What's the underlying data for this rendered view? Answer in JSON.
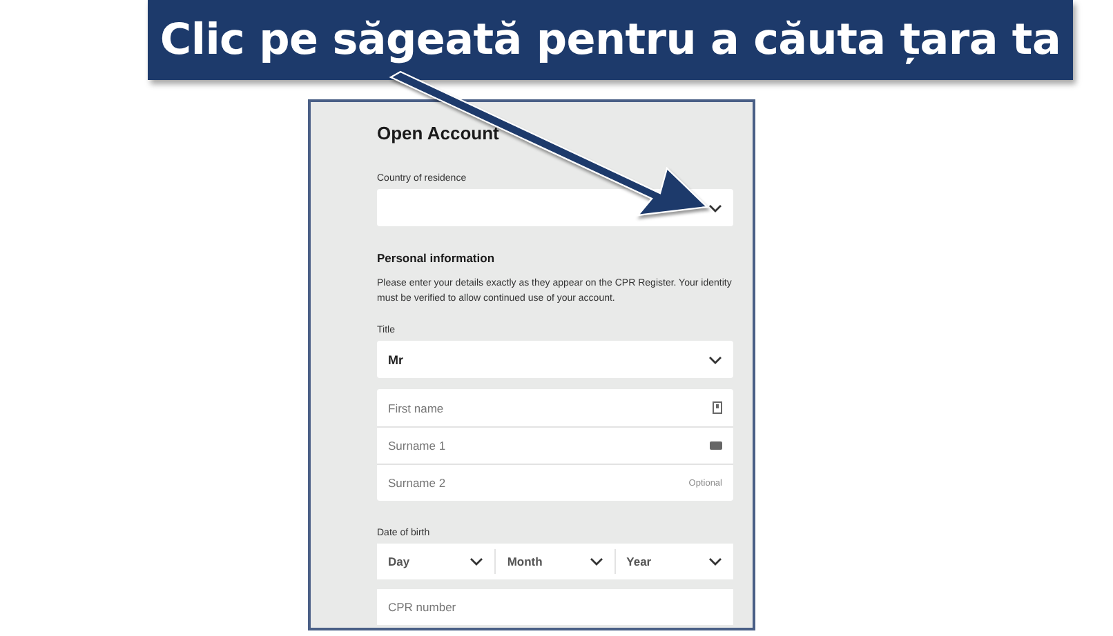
{
  "banner": {
    "text": "Clic pe săgeată pentru a căuta țara ta"
  },
  "form": {
    "title": "Open Account",
    "country": {
      "label": "Country of residence"
    },
    "section_title": "Personal information",
    "description": "Please enter your details exactly as they appear on the CPR Register. Your identity must be verified to allow continued use of your account.",
    "title_field": {
      "label": "Title",
      "value": "Mr"
    },
    "name_fields": [
      {
        "placeholder": "First name",
        "kind": "contact"
      },
      {
        "placeholder": "Surname 1",
        "kind": "card"
      },
      {
        "placeholder": "Surname 2",
        "kind": "optional",
        "hint": "Optional"
      }
    ],
    "dob": {
      "label": "Date of birth",
      "parts": [
        "Day",
        "Month",
        "Year"
      ]
    },
    "cpr": {
      "placeholder": "CPR number"
    }
  }
}
